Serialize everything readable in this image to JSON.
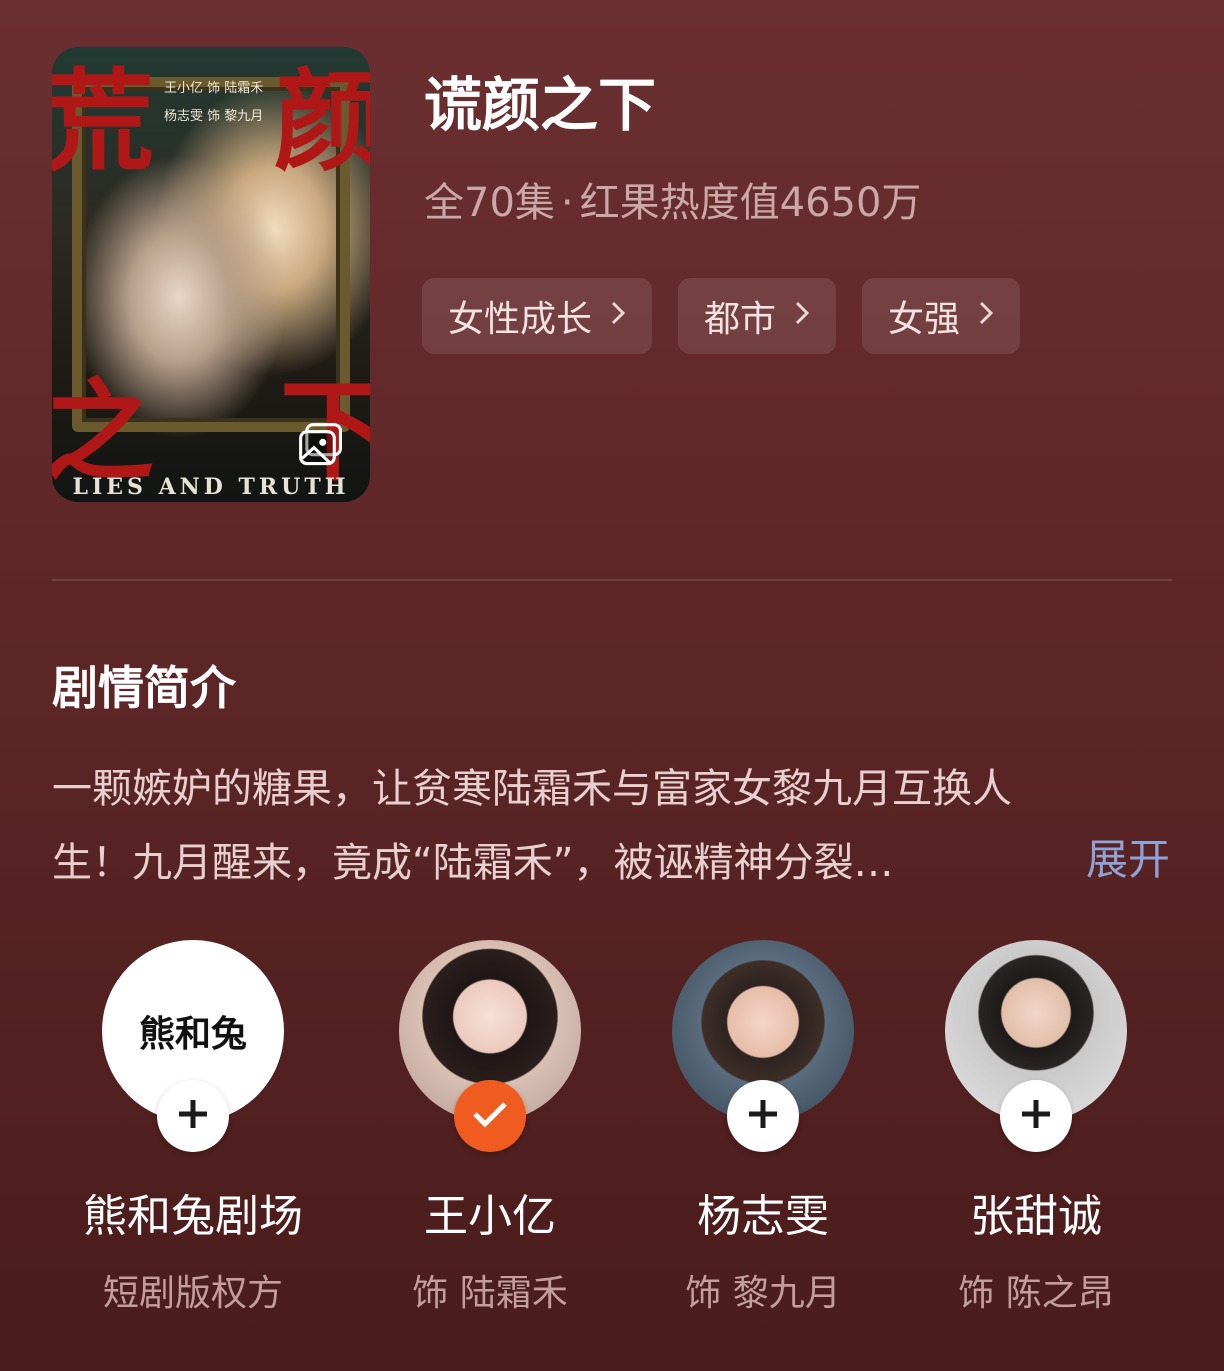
{
  "drama": {
    "title": "谎颜之下",
    "episodes": "全70集",
    "separator": "·",
    "heat": "红果热度值4650万",
    "tags": [
      {
        "label": "女性成长"
      },
      {
        "label": "都市"
      },
      {
        "label": "女强"
      }
    ]
  },
  "poster": {
    "credit_1": "王小亿 饰 陆霜禾",
    "credit_2": "杨志雯 饰 黎九月",
    "title_chars": [
      "荒",
      "颜",
      "之",
      "下"
    ],
    "english": "LIES AND TRUTH",
    "icon": "image-preview-icon"
  },
  "synopsis": {
    "heading": "剧情简介",
    "line_1": "一颗嫉妒的糖果，让贫寒陆霜禾与富家女黎九月互换人",
    "line_2": "生！九月醒来，竟成“陆霜禾”，被诬精神分裂…",
    "expand_label": "展开"
  },
  "cast": [
    {
      "name": "熊和兔剧场",
      "role": "短剧版权方",
      "logo_text": "熊和兔",
      "status": "follow",
      "icon": "plus-icon"
    },
    {
      "name": "王小亿",
      "role": "饰 陆霜禾",
      "status": "followed",
      "icon": "check-icon"
    },
    {
      "name": "杨志雯",
      "role": "饰 黎九月",
      "status": "follow",
      "icon": "plus-icon"
    },
    {
      "name": "张甜诚",
      "role": "饰 陈之昂",
      "status": "follow",
      "icon": "plus-icon"
    }
  ],
  "colors": {
    "background": "#5e2627",
    "accent_blue": "#8fa4d6",
    "follow_orange": "#f05b20"
  }
}
